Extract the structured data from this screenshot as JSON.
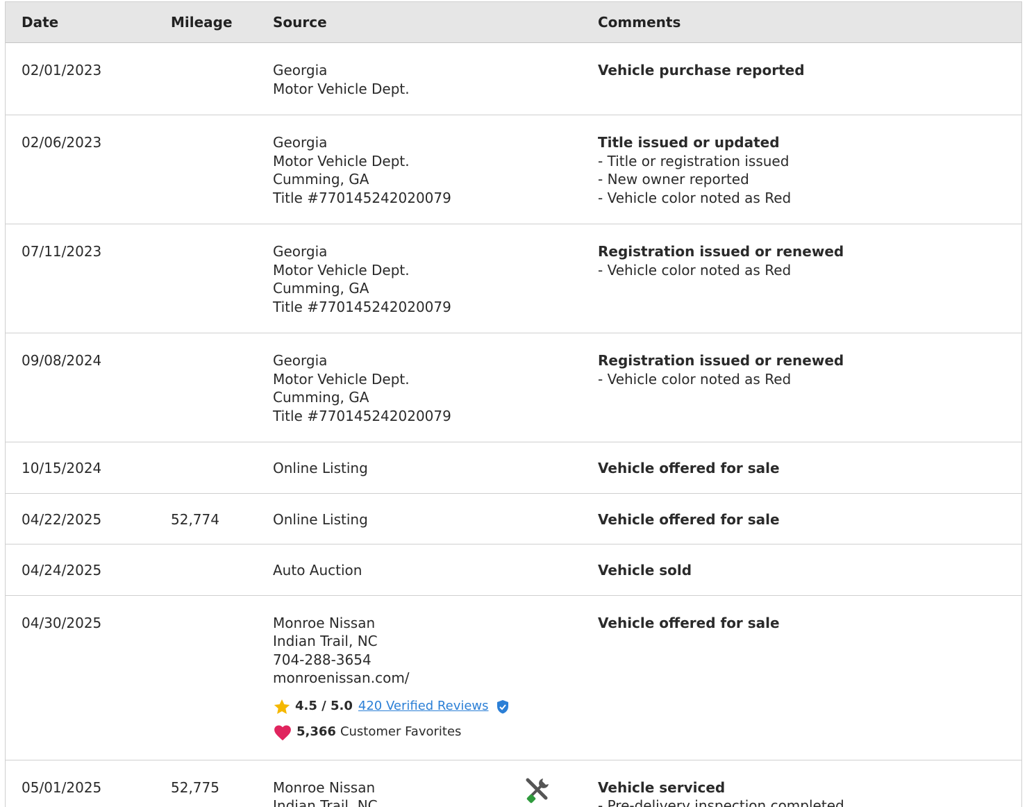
{
  "columns": {
    "date": "Date",
    "mileage": "Mileage",
    "source": "Source",
    "comments": "Comments"
  },
  "rows": [
    {
      "date": "02/01/2023",
      "mileage": "",
      "source": [
        "Georgia",
        "Motor Vehicle Dept."
      ],
      "comment_title": "Vehicle purchase reported",
      "comment_items": []
    },
    {
      "date": "02/06/2023",
      "mileage": "",
      "source": [
        "Georgia",
        "Motor Vehicle Dept.",
        "Cumming, GA",
        "Title #770145242020079"
      ],
      "comment_title": "Title issued or updated",
      "comment_items": [
        "- Title or registration issued",
        "- New owner reported",
        "- Vehicle color noted as Red"
      ]
    },
    {
      "date": "07/11/2023",
      "mileage": "",
      "source": [
        "Georgia",
        "Motor Vehicle Dept.",
        "Cumming, GA",
        "Title #770145242020079"
      ],
      "comment_title": "Registration issued or renewed",
      "comment_items": [
        "- Vehicle color noted as Red"
      ]
    },
    {
      "date": "09/08/2024",
      "mileage": "",
      "source": [
        "Georgia",
        "Motor Vehicle Dept.",
        "Cumming, GA",
        "Title #770145242020079"
      ],
      "comment_title": "Registration issued or renewed",
      "comment_items": [
        "- Vehicle color noted as Red"
      ]
    },
    {
      "date": "10/15/2024",
      "mileage": "",
      "source": [
        "Online Listing"
      ],
      "comment_title": "Vehicle offered for sale",
      "comment_items": []
    },
    {
      "date": "04/22/2025",
      "mileage": "52,774",
      "source": [
        "Online Listing"
      ],
      "comment_title": "Vehicle offered for sale",
      "comment_items": []
    },
    {
      "date": "04/24/2025",
      "mileage": "",
      "source": [
        "Auto Auction"
      ],
      "comment_title": "Vehicle sold",
      "comment_items": []
    },
    {
      "date": "04/30/2025",
      "mileage": "",
      "source": [
        "Monroe Nissan",
        "Indian Trail, NC",
        "704-288-3654",
        "monroenissan.com/"
      ],
      "dealer": {
        "rating": "4.5 / 5.0",
        "reviews": "420 Verified Reviews",
        "favorites_count": "5,366",
        "favorites_label": "Customer Favorites"
      },
      "comment_title": "Vehicle offered for sale",
      "comment_items": []
    },
    {
      "date": "05/01/2025",
      "mileage": "52,775",
      "source": [
        "Monroe Nissan",
        "Indian Trail, NC"
      ],
      "service_icon": true,
      "comment_title": "Vehicle serviced",
      "comment_items": [
        "- Pre-delivery inspection completed"
      ]
    }
  ],
  "colors": {
    "header_bg": "#e6e6e6",
    "link": "#2b7fd6",
    "star": "#f5b800",
    "heart": "#e0245e",
    "verified": "#2b7fd6"
  }
}
